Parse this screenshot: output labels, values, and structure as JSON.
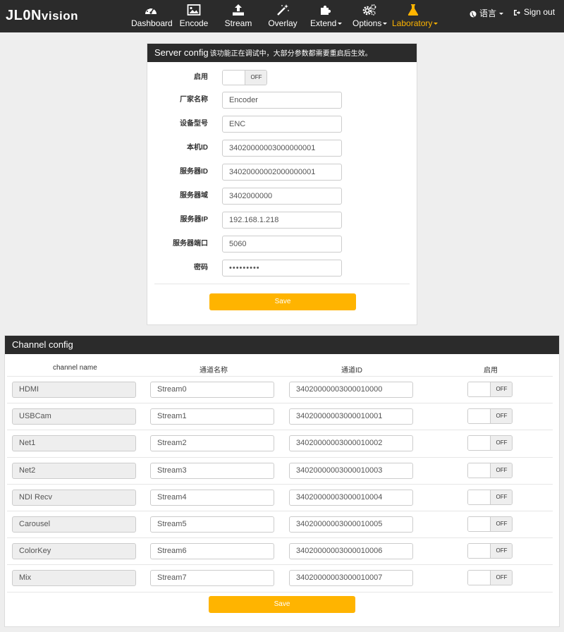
{
  "brand": {
    "name_main": "JL0N",
    "name_small": "vision"
  },
  "nav": {
    "items": [
      {
        "label": "Dashboard",
        "icon": "dashboard-icon",
        "dropdown": false,
        "active": false
      },
      {
        "label": "Encode",
        "icon": "picture-icon",
        "dropdown": false,
        "active": false
      },
      {
        "label": "Stream",
        "icon": "upload-icon",
        "dropdown": false,
        "active": false
      },
      {
        "label": "Overlay",
        "icon": "magic-wand-icon",
        "dropdown": false,
        "active": false
      },
      {
        "label": "Extend",
        "icon": "puzzle-icon",
        "dropdown": true,
        "active": false
      },
      {
        "label": "Options",
        "icon": "gears-icon",
        "dropdown": true,
        "active": false
      },
      {
        "label": "Laboratory",
        "icon": "flask-icon",
        "dropdown": true,
        "active": true
      }
    ],
    "language": "语言",
    "signout": "Sign out",
    "active_color": "#ffb400"
  },
  "server": {
    "title": "Server config",
    "subtitle": "该功能正在调试中，大部分参数都需要重启后生效。",
    "enable_label": "启用",
    "enable_state": "OFF",
    "fields": [
      {
        "label": "厂家名称",
        "value": "Encoder"
      },
      {
        "label": "设备型号",
        "value": "ENC"
      },
      {
        "label": "本机ID",
        "value": "34020000003000000001"
      },
      {
        "label": "服务器ID",
        "value": "34020000002000000001"
      },
      {
        "label": "服务器域",
        "value": "3402000000"
      },
      {
        "label": "服务器IP",
        "value": "192.168.1.218"
      },
      {
        "label": "服务器端口",
        "value": "5060"
      },
      {
        "label": "密码",
        "value": "•••••••••"
      }
    ],
    "save": "Save"
  },
  "channel": {
    "title": "Channel config",
    "headers": {
      "name": "channel name",
      "stream": "通道名称",
      "id": "通道ID",
      "enable": "启用"
    },
    "rows": [
      {
        "name": "HDMI",
        "stream": "Stream0",
        "id": "34020000003000010000",
        "state": "OFF"
      },
      {
        "name": "USBCam",
        "stream": "Stream1",
        "id": "34020000003000010001",
        "state": "OFF"
      },
      {
        "name": "Net1",
        "stream": "Stream2",
        "id": "34020000003000010002",
        "state": "OFF"
      },
      {
        "name": "Net2",
        "stream": "Stream3",
        "id": "34020000003000010003",
        "state": "OFF"
      },
      {
        "name": "NDI Recv",
        "stream": "Stream4",
        "id": "34020000003000010004",
        "state": "OFF"
      },
      {
        "name": "Carousel",
        "stream": "Stream5",
        "id": "34020000003000010005",
        "state": "OFF"
      },
      {
        "name": "ColorKey",
        "stream": "Stream6",
        "id": "34020000003000010006",
        "state": "OFF"
      },
      {
        "name": "Mix",
        "stream": "Stream7",
        "id": "34020000003000010007",
        "state": "OFF"
      }
    ],
    "save": "Save"
  },
  "colors": {
    "nav_bg": "#2b2b2b",
    "accent": "#ffb400",
    "page_bg": "#eeeeee"
  }
}
